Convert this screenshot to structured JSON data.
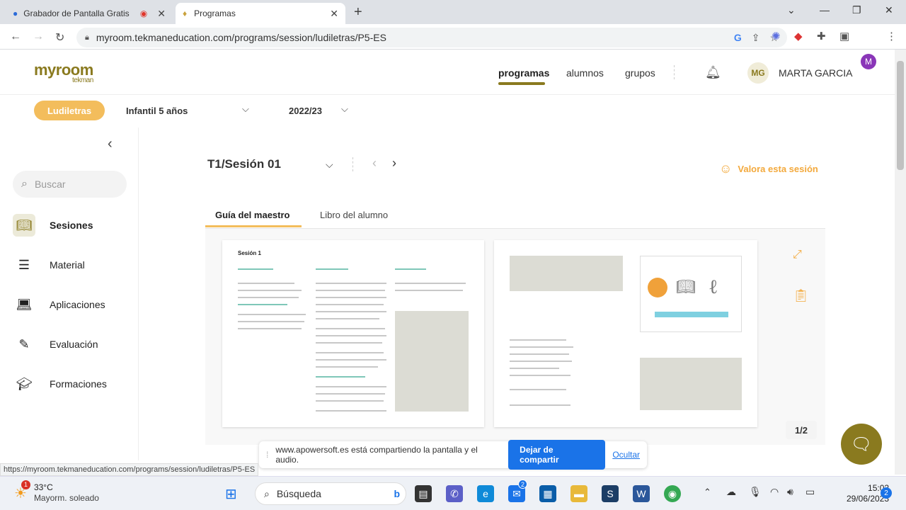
{
  "browser": {
    "tabs": [
      {
        "title": "Grabador de Pantalla Gratis"
      },
      {
        "title": "Programas"
      }
    ],
    "url": "myroom.tekmaneducation.com/programs/session/ludiletras/P5-ES",
    "profile_initial": "M",
    "status_url": "https://myroom.tekmaneducation.com/programs/session/ludiletras/P5-ES"
  },
  "header": {
    "logo": "myroom",
    "logo_sub": "tekman",
    "nav": {
      "programas": "programas",
      "alumnos": "alumnos",
      "grupos": "grupos"
    },
    "avatar_initials": "MG",
    "user_name": "MARTA GARCIA"
  },
  "filters": {
    "program": "Ludiletras",
    "level": "Infantil 5 años",
    "year": "2022/23"
  },
  "sidebar": {
    "search_placeholder": "Buscar",
    "items": [
      {
        "label": "Sesiones",
        "icon": "book-icon"
      },
      {
        "label": "Material",
        "icon": "stack-icon"
      },
      {
        "label": "Aplicaciones",
        "icon": "laptop-icon"
      },
      {
        "label": "Evaluación",
        "icon": "evaluation-icon"
      },
      {
        "label": "Formaciones",
        "icon": "graduation-cap-icon"
      }
    ]
  },
  "main": {
    "session_title": "T1/Sesión 01",
    "rate_label": "Valora esta sesión",
    "tabs": {
      "guide": "Guía del maestro",
      "student": "Libro del alumno"
    },
    "page_title": "Sesión 1",
    "page_count": "1/2"
  },
  "sharebar": {
    "message": "www.apowersoft.es está compartiendo la pantalla y el audio.",
    "stop": "Dejar de compartir",
    "hide": "Ocultar"
  },
  "taskbar": {
    "temperature": "33°C",
    "weather": "Mayorm. soleado",
    "weather_badge": "1",
    "search": "Búsqueda",
    "mail_badge": "2",
    "time": "15:02",
    "date": "29/06/2023",
    "notif_count": "2"
  },
  "colors": {
    "accent": "#8a7a1f",
    "pill": "#f3bd5c",
    "link": "#1a73e8",
    "rate": "#f3a93c"
  }
}
